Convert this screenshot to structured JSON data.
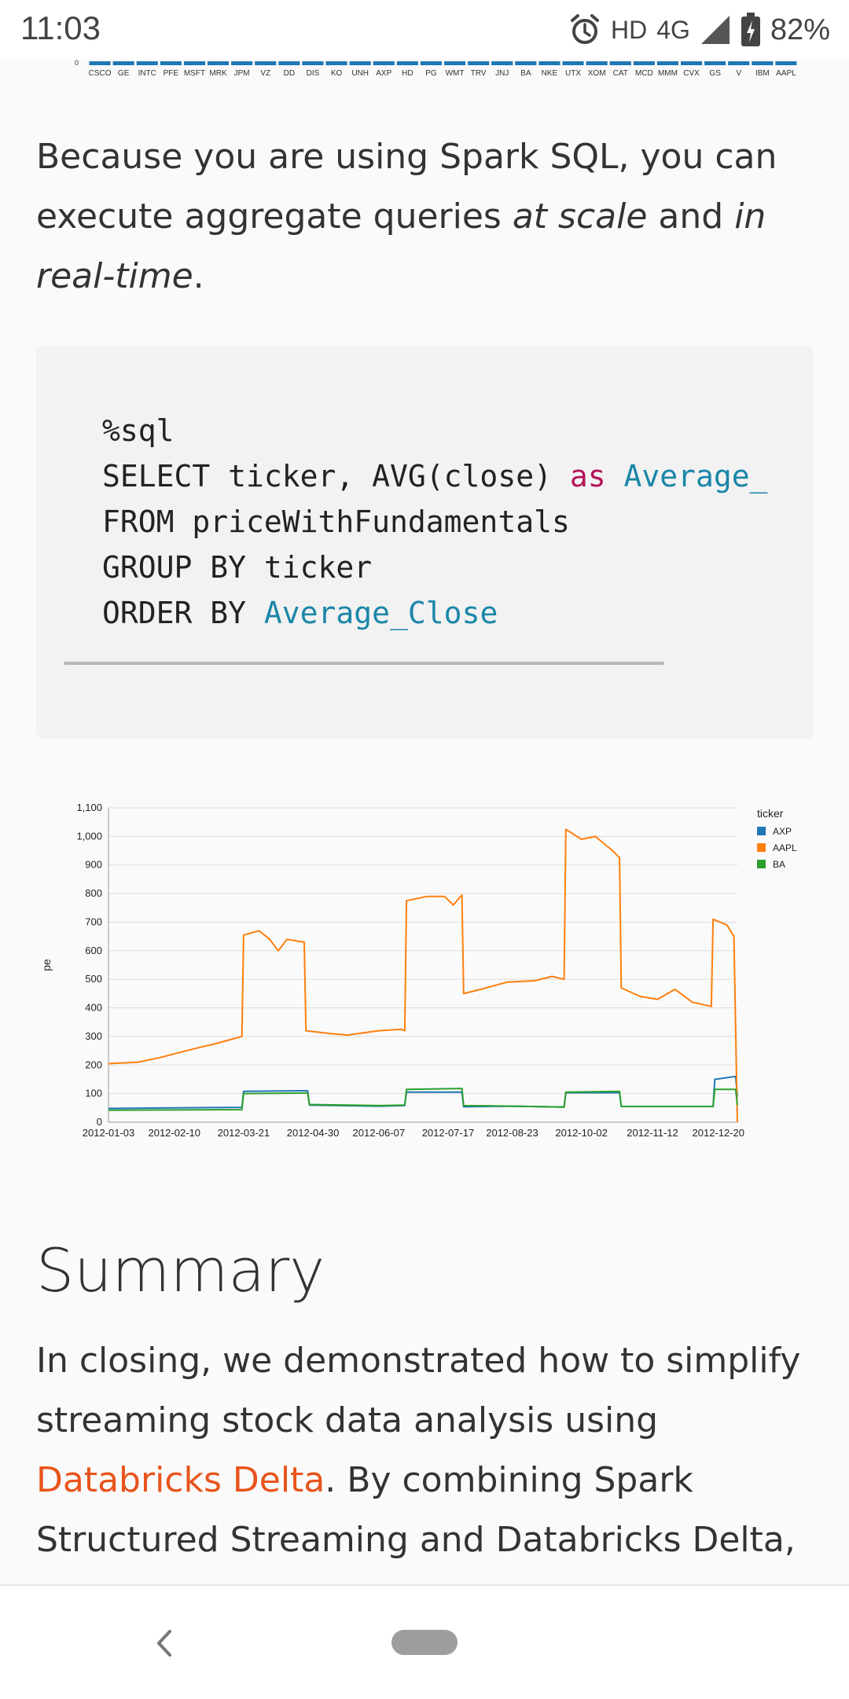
{
  "status": {
    "time": "11:03",
    "hd": "HD",
    "network": "4G",
    "battery": "82%"
  },
  "top_chart": {
    "y_tick": "0",
    "categories": [
      "CSCO",
      "GE",
      "INTC",
      "PFE",
      "MSFT",
      "MRK",
      "JPM",
      "VZ",
      "DD",
      "DIS",
      "KO",
      "UNH",
      "AXP",
      "HD",
      "PG",
      "WMT",
      "TRV",
      "JNJ",
      "BA",
      "NKE",
      "UTX",
      "XOM",
      "CAT",
      "MCD",
      "MMM",
      "CVX",
      "GS",
      "V",
      "IBM",
      "AAPL"
    ],
    "bar_color": "#1f77b4"
  },
  "intro": {
    "part1": "Because you are using Spark SQL, you can execute aggregate queries ",
    "em1": "at scale",
    "part2": " and ",
    "em2": "in real-time",
    "part3": "."
  },
  "code": {
    "line1": "%sql",
    "line2_a": "SELECT ticker, AVG(close) ",
    "line2_as": "as",
    "line2_id": " Average_",
    "line3": "FROM priceWithFundamentals",
    "line4": "GROUP BY ticker",
    "line5_a": "ORDER BY ",
    "line5_id": "Average_Close"
  },
  "chart_data": {
    "type": "line",
    "ylabel": "pe",
    "legend_title": "ticker",
    "legend_position": "top-right",
    "ylim": [
      0,
      1100
    ],
    "yticks": [
      0,
      100,
      200,
      300,
      400,
      500,
      600,
      700,
      800,
      900,
      1000,
      1100
    ],
    "ytick_labels": [
      "0",
      "100",
      "200",
      "300",
      "400",
      "500",
      "600",
      "700",
      "800",
      "900",
      "1,000",
      "1,100"
    ],
    "xlim": [
      "2012-01-03",
      "2012-12-31"
    ],
    "xtick_labels": [
      "2012-01-03",
      "2012-02-10",
      "2012-03-21",
      "2012-04-30",
      "2012-06-07",
      "2012-07-17",
      "2012-08-23",
      "2012-10-02",
      "2012-11-12",
      "2012-12-20"
    ],
    "grid": true,
    "series": [
      {
        "name": "AXP",
        "color": "#1f77b4",
        "points": [
          [
            "2012-01-03",
            48
          ],
          [
            "2012-02-10",
            50
          ],
          [
            "2012-03-20",
            52
          ],
          [
            "2012-03-21",
            108
          ],
          [
            "2012-04-25",
            110
          ],
          [
            "2012-04-27",
            110
          ],
          [
            "2012-04-28",
            60
          ],
          [
            "2012-06-07",
            56
          ],
          [
            "2012-06-22",
            58
          ],
          [
            "2012-06-23",
            105
          ],
          [
            "2012-07-25",
            105
          ],
          [
            "2012-07-26",
            54
          ],
          [
            "2012-08-23",
            56
          ],
          [
            "2012-09-22",
            53
          ],
          [
            "2012-09-23",
            103
          ],
          [
            "2012-10-24",
            103
          ],
          [
            "2012-10-25",
            55
          ],
          [
            "2012-12-15",
            55
          ],
          [
            "2012-12-17",
            55
          ],
          [
            "2012-12-18",
            150
          ],
          [
            "2012-12-30",
            160
          ],
          [
            "2012-12-31",
            90
          ]
        ]
      },
      {
        "name": "AAPL",
        "color": "#ff7f0e",
        "points": [
          [
            "2012-01-03",
            205
          ],
          [
            "2012-01-20",
            210
          ],
          [
            "2012-02-01",
            225
          ],
          [
            "2012-02-20",
            255
          ],
          [
            "2012-03-05",
            275
          ],
          [
            "2012-03-20",
            300
          ],
          [
            "2012-03-21",
            655
          ],
          [
            "2012-03-30",
            670
          ],
          [
            "2012-04-05",
            640
          ],
          [
            "2012-04-10",
            600
          ],
          [
            "2012-04-15",
            640
          ],
          [
            "2012-04-25",
            630
          ],
          [
            "2012-04-26",
            320
          ],
          [
            "2012-05-10",
            310
          ],
          [
            "2012-05-20",
            305
          ],
          [
            "2012-06-07",
            320
          ],
          [
            "2012-06-20",
            325
          ],
          [
            "2012-06-22",
            320
          ],
          [
            "2012-06-23",
            775
          ],
          [
            "2012-07-05",
            790
          ],
          [
            "2012-07-15",
            790
          ],
          [
            "2012-07-20",
            760
          ],
          [
            "2012-07-25",
            795
          ],
          [
            "2012-07-26",
            450
          ],
          [
            "2012-08-05",
            465
          ],
          [
            "2012-08-20",
            490
          ],
          [
            "2012-09-05",
            495
          ],
          [
            "2012-09-15",
            510
          ],
          [
            "2012-09-22",
            500
          ],
          [
            "2012-09-23",
            1025
          ],
          [
            "2012-10-02",
            990
          ],
          [
            "2012-10-10",
            1000
          ],
          [
            "2012-10-20",
            950
          ],
          [
            "2012-10-24",
            925
          ],
          [
            "2012-10-25",
            470
          ],
          [
            "2012-11-05",
            440
          ],
          [
            "2012-11-15",
            430
          ],
          [
            "2012-11-25",
            465
          ],
          [
            "2012-12-05",
            420
          ],
          [
            "2012-12-16",
            405
          ],
          [
            "2012-12-17",
            710
          ],
          [
            "2012-12-25",
            690
          ],
          [
            "2012-12-29",
            650
          ],
          [
            "2012-12-31",
            0
          ]
        ]
      },
      {
        "name": "BA",
        "color": "#2ca02c",
        "points": [
          [
            "2012-01-03",
            42
          ],
          [
            "2012-02-10",
            43
          ],
          [
            "2012-03-20",
            44
          ],
          [
            "2012-03-21",
            100
          ],
          [
            "2012-04-25",
            102
          ],
          [
            "2012-04-27",
            102
          ],
          [
            "2012-04-28",
            62
          ],
          [
            "2012-06-07",
            58
          ],
          [
            "2012-06-22",
            60
          ],
          [
            "2012-06-23",
            115
          ],
          [
            "2012-07-25",
            118
          ],
          [
            "2012-07-26",
            58
          ],
          [
            "2012-08-23",
            56
          ],
          [
            "2012-09-22",
            53
          ],
          [
            "2012-09-23",
            105
          ],
          [
            "2012-10-24",
            108
          ],
          [
            "2012-10-25",
            55
          ],
          [
            "2012-12-15",
            55
          ],
          [
            "2012-12-17",
            55
          ],
          [
            "2012-12-18",
            115
          ],
          [
            "2012-12-30",
            115
          ],
          [
            "2012-12-31",
            60
          ]
        ]
      }
    ]
  },
  "summary": {
    "heading": "Summary",
    "text1": "In closing, we demonstrated how to simplify streaming stock data analysis using ",
    "link": "Databricks Delta",
    "text2": ".  By combining Spark Structured Streaming and Databricks Delta,"
  }
}
